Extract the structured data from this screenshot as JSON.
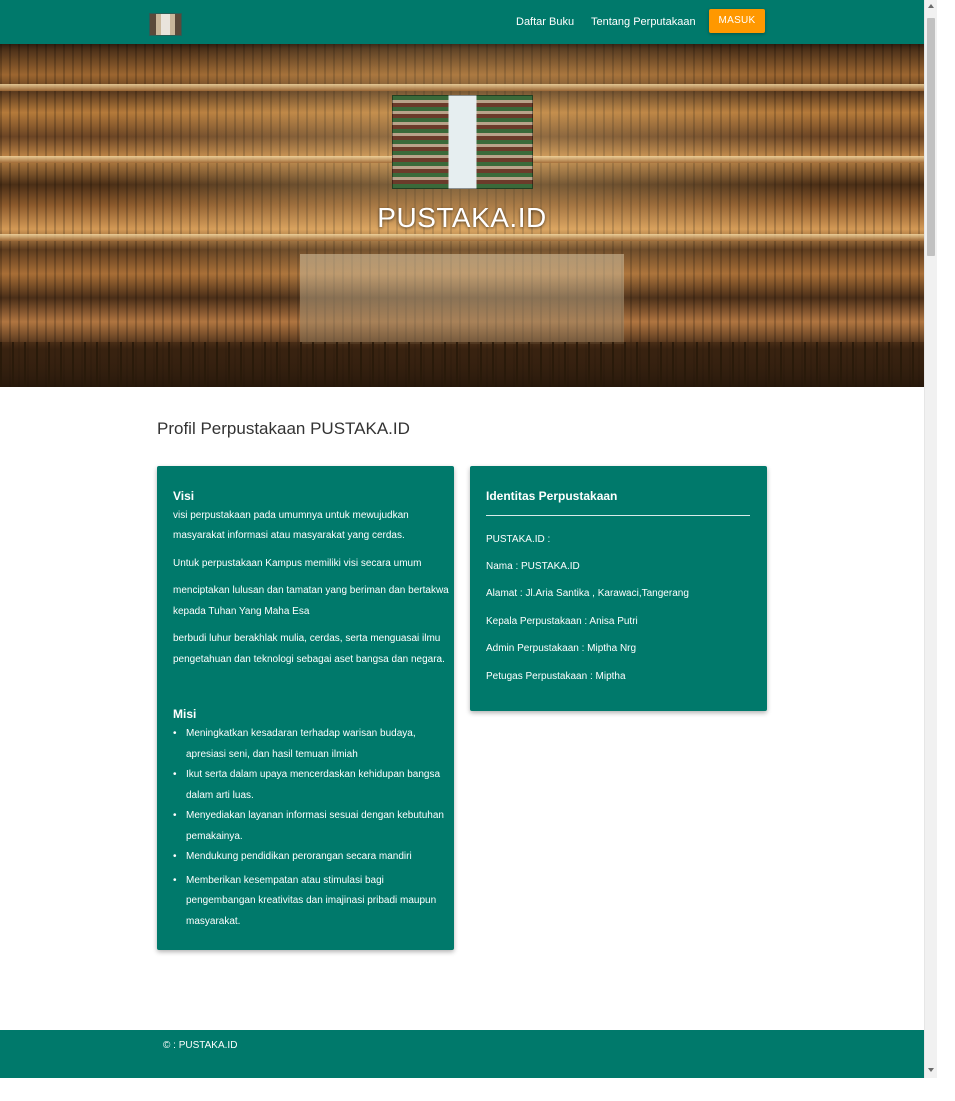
{
  "navbar": {
    "logo_icon": "library-logo-icon",
    "links": [
      {
        "label": "Daftar Buku"
      },
      {
        "label": "Tentang Perputakaan"
      }
    ],
    "login_label": "MASUK",
    "colors": {
      "bar": "#00796b",
      "button": "#ff9800"
    }
  },
  "hero": {
    "title": "PUSTAKA.ID"
  },
  "main": {
    "section_title": "Profil Perpustakaan PUSTAKA.ID",
    "visi": {
      "heading": "Visi",
      "lines": [
        "visi perpustakaan pada umumnya untuk mewujudkan",
        "masyarakat informasi atau masyarakat yang cerdas.",
        "Untuk perpustakaan Kampus memiliki visi secara umum",
        "menciptakan lulusan dan tamatan yang beriman dan bertakwa",
        "kepada Tuhan Yang Maha Esa",
        "berbudi luhur berakhlak mulia, cerdas, serta menguasai ilmu",
        "pengetahuan dan teknologi sebagai aset bangsa dan negara."
      ]
    },
    "misi": {
      "heading": "Misi",
      "bullet": "•",
      "items": [
        [
          "Meningkatkan kesadaran terhadap warisan budaya,",
          "apresiasi seni, dan hasil temuan ilmiah"
        ],
        [
          "Ikut serta dalam upaya mencerdaskan kehidupan bangsa",
          "dalam arti luas."
        ],
        [
          "Menyediakan layanan informasi sesuai dengan kebutuhan",
          "pemakainya."
        ],
        [
          "Mendukung pendidikan perorangan secara mandiri"
        ],
        [
          "Memberikan kesempatan atau stimulasi bagi",
          "pengembangan kreativitas dan imajinasi pribadi maupun",
          "masyarakat."
        ]
      ]
    },
    "identitas": {
      "heading": "Identitas Perpustakaan",
      "rows": [
        "PUSTAKA.ID :",
        "Nama : PUSTAKA.ID",
        "Alamat : Jl.Aria Santika , Karawaci,Tangerang",
        "Kepala Perpustakaan : Anisa Putri",
        "Admin Perpustakaan : Miptha Nrg",
        "Petugas Perpustakaan : Miptha"
      ]
    }
  },
  "footer": {
    "text": "© : PUSTAKA.ID"
  }
}
